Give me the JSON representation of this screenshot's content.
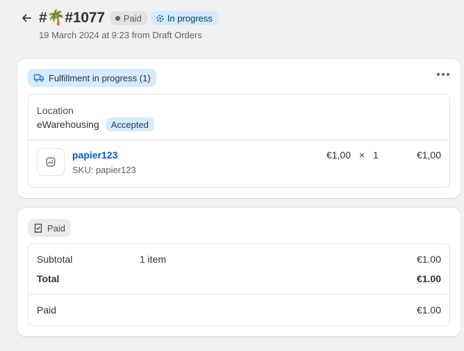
{
  "order": {
    "title": "#🌴#1077",
    "payment_badge": "Paid",
    "status_badge": "In progress",
    "subtitle": "19 March 2024 at 9:23 from Draft Orders"
  },
  "fulfillment": {
    "status_label": "Fulfillment in progress (1)",
    "location_label": "Location",
    "location_name": "eWarehousing",
    "location_badge": "Accepted",
    "item": {
      "name": "papier123",
      "sku": "SKU: papier123",
      "price": "€1,00",
      "times": "×",
      "quantity": "1",
      "total": "€1,00"
    }
  },
  "payment": {
    "status_label": "Paid",
    "rows": [
      {
        "label": "Subtotal",
        "detail": "1 item",
        "value": "€1.00"
      },
      {
        "label": "Total",
        "detail": "",
        "value": "€1.00"
      },
      {
        "label": "Paid",
        "detail": "",
        "value": "€1.00"
      }
    ]
  },
  "colors": {
    "page_bg": "#f1f1f1",
    "info_badge_bg": "#d5ebff",
    "link": "#005bd3",
    "neutral_badge_bg": "#e3e3e3"
  },
  "icons": [
    "back-arrow-icon",
    "palm-tree-emoji",
    "dot-icon",
    "in-progress-icon",
    "truck-icon",
    "more-horizontal-icon",
    "image-placeholder-icon",
    "receipt-check-icon"
  ]
}
